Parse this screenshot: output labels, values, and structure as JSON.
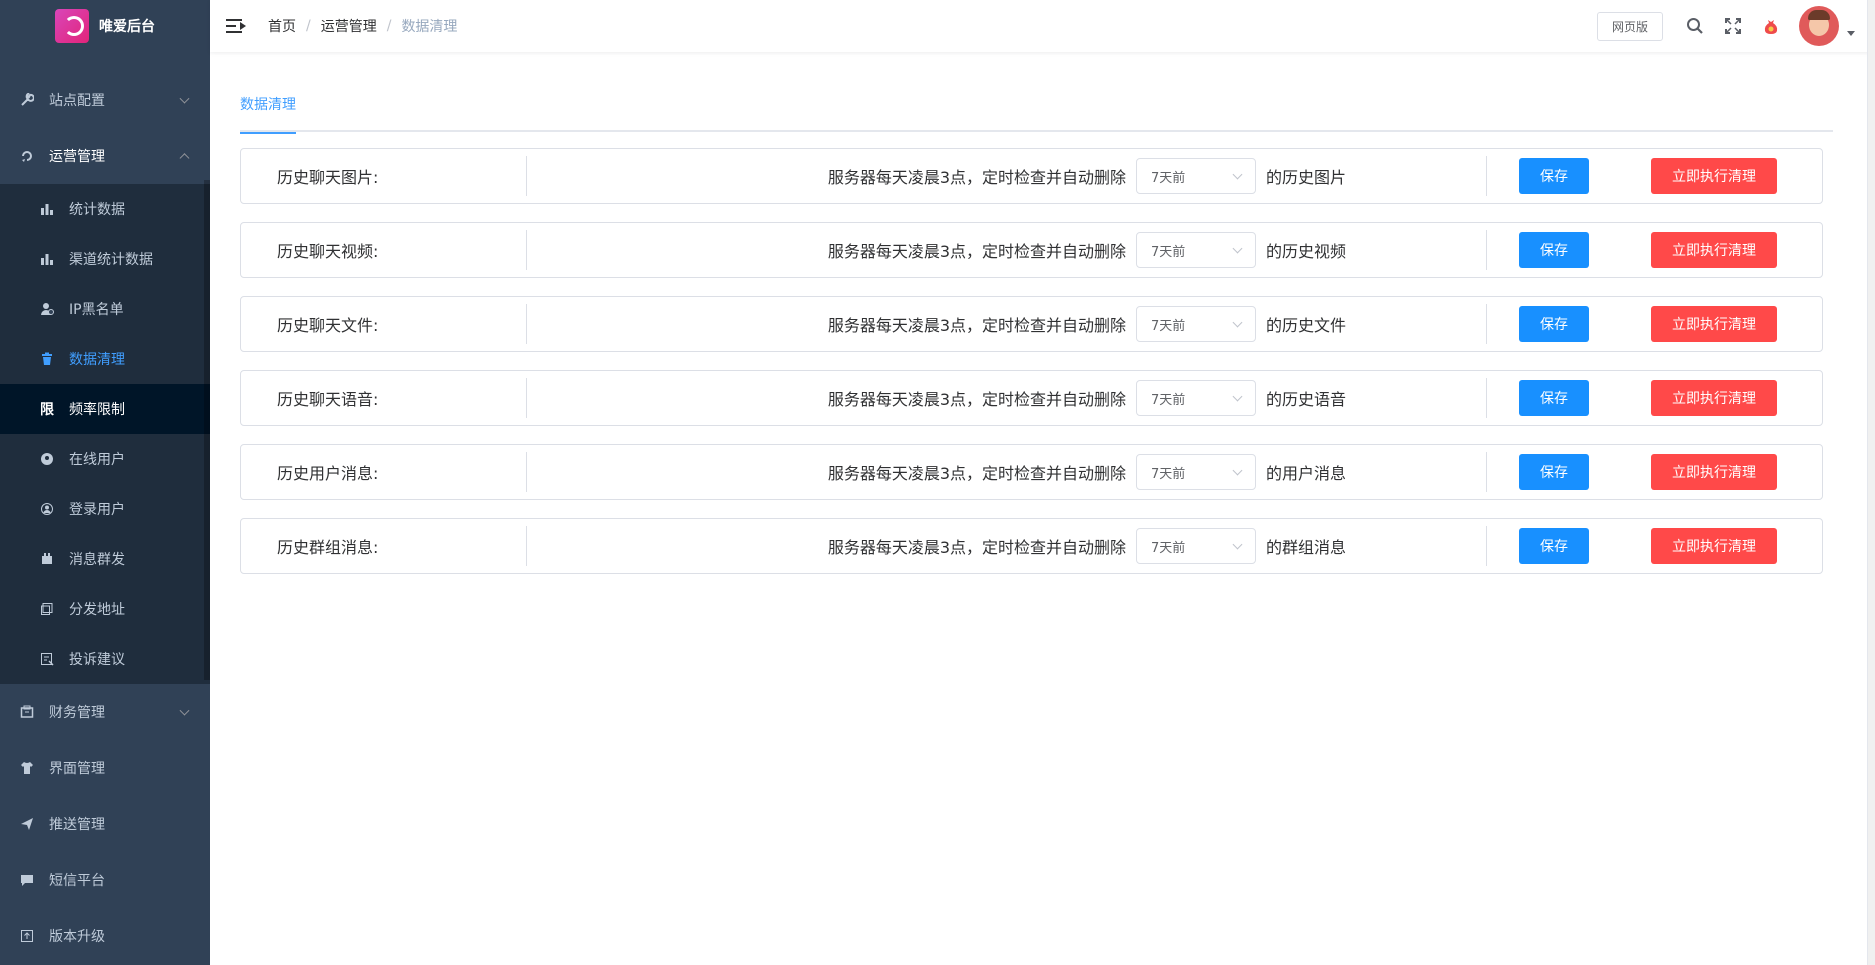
{
  "app": {
    "title": "唯爱后台"
  },
  "sidebar": {
    "menus": [
      {
        "label": "站点配置",
        "icon": "wrench-icon",
        "expanded": false
      },
      {
        "label": "运营管理",
        "icon": "operation-icon",
        "expanded": true
      }
    ],
    "operation_items": [
      {
        "label": "统计数据",
        "icon": "bar-chart-icon",
        "glyph": "▮"
      },
      {
        "label": "渠道统计数据",
        "icon": "bar-chart-icon",
        "glyph": "▮"
      },
      {
        "label": "IP黑名单",
        "icon": "user-block-icon",
        "glyph": "●"
      },
      {
        "label": "数据清理",
        "icon": "trash-icon",
        "glyph": "▣"
      },
      {
        "label": "频率限制",
        "icon": "limit-icon",
        "glyph": "限"
      },
      {
        "label": "在线用户",
        "icon": "online-user-icon",
        "glyph": "◉"
      },
      {
        "label": "登录用户",
        "icon": "login-user-icon",
        "glyph": "◎"
      },
      {
        "label": "消息群发",
        "icon": "broadcast-icon",
        "glyph": "▤"
      },
      {
        "label": "分发地址",
        "icon": "address-icon",
        "glyph": "◫"
      },
      {
        "label": "投诉建议",
        "icon": "complaint-icon",
        "glyph": "◩"
      }
    ],
    "bottom_menus": [
      {
        "label": "财务管理",
        "icon": "finance-icon",
        "glyph": "▦"
      },
      {
        "label": "界面管理",
        "icon": "shirt-icon",
        "glyph": "▼"
      },
      {
        "label": "推送管理",
        "icon": "send-icon",
        "glyph": "➤"
      },
      {
        "label": "短信平台",
        "icon": "chat-icon",
        "glyph": "▬"
      },
      {
        "label": "版本升级",
        "icon": "upgrade-icon",
        "glyph": "⊡"
      }
    ]
  },
  "header": {
    "breadcrumb": [
      "首页",
      "运营管理",
      "数据清理"
    ],
    "web_button": "网页版"
  },
  "main": {
    "tab": "数据清理",
    "description": "服务器每天凌晨3点，定时检查并自动删除",
    "save_label": "保存",
    "clean_label": "立即执行清理",
    "rows": [
      {
        "label": "历史聊天图片:",
        "select": "7天前",
        "suffix": "的历史图片"
      },
      {
        "label": "历史聊天视频:",
        "select": "7天前",
        "suffix": "的历史视频"
      },
      {
        "label": "历史聊天文件:",
        "select": "7天前",
        "suffix": "的历史文件"
      },
      {
        "label": "历史聊天语音:",
        "select": "7天前",
        "suffix": "的历史语音"
      },
      {
        "label": "历史用户消息:",
        "select": "7天前",
        "suffix": "的用户消息"
      },
      {
        "label": "历史群组消息:",
        "select": "7天前",
        "suffix": "的群组消息"
      }
    ]
  },
  "colors": {
    "sidebar": "#304156",
    "submenu": "#1f2d3d",
    "primary": "#1890ff",
    "danger": "#ff4949",
    "active": "#409eff"
  }
}
